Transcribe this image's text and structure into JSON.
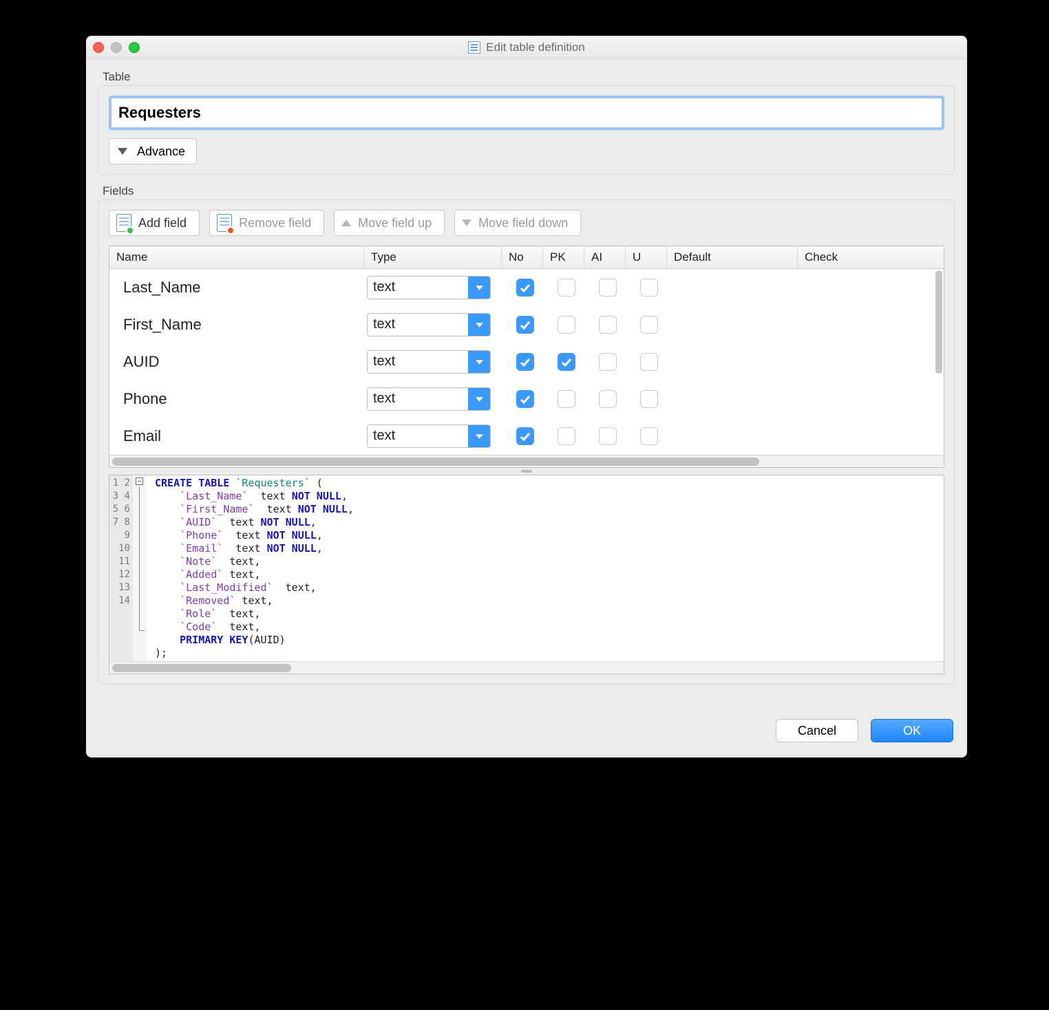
{
  "window": {
    "title": "Edit table definition"
  },
  "table_section": {
    "label": "Table",
    "name_value": "Requesters",
    "advance_label": "Advance"
  },
  "fields_section": {
    "label": "Fields",
    "toolbar": {
      "add": "Add field",
      "remove": "Remove field",
      "move_up": "Move field up",
      "move_down": "Move field down"
    },
    "columns": {
      "name": "Name",
      "type": "Type",
      "no": "No",
      "pk": "PK",
      "ai": "AI",
      "u": "U",
      "default": "Default",
      "check": "Check"
    },
    "rows": [
      {
        "name": "Last_Name",
        "type": "text",
        "no": true,
        "pk": false,
        "ai": false,
        "u": false,
        "default": "",
        "check": ""
      },
      {
        "name": "First_Name",
        "type": "text",
        "no": true,
        "pk": false,
        "ai": false,
        "u": false,
        "default": "",
        "check": ""
      },
      {
        "name": "AUID",
        "type": "text",
        "no": true,
        "pk": true,
        "ai": false,
        "u": false,
        "default": "",
        "check": ""
      },
      {
        "name": "Phone",
        "type": "text",
        "no": true,
        "pk": false,
        "ai": false,
        "u": false,
        "default": "",
        "check": ""
      },
      {
        "name": "Email",
        "type": "text",
        "no": true,
        "pk": false,
        "ai": false,
        "u": false,
        "default": "",
        "check": ""
      }
    ]
  },
  "sql": {
    "line_count": 14,
    "lines": [
      {
        "t": "kw",
        "text": "CREATE TABLE",
        "tail_tbl": "`Requesters`",
        "tail_plain": " ("
      },
      {
        "fld": "`Last_Name`",
        "plain": "  text ",
        "kw": "NOT NULL",
        "end": ","
      },
      {
        "fld": "`First_Name`",
        "plain": "  text ",
        "kw": "NOT NULL",
        "end": ","
      },
      {
        "fld": "`AUID`",
        "plain": "  text ",
        "kw": "NOT NULL",
        "end": ","
      },
      {
        "fld": "`Phone`",
        "plain": "  text ",
        "kw": "NOT NULL",
        "end": ","
      },
      {
        "fld": "`Email`",
        "plain": "  text ",
        "kw": "NOT NULL",
        "end": ","
      },
      {
        "fld": "`Note`",
        "plain": "  text,",
        "kw": "",
        "end": ""
      },
      {
        "fld": "`Added`",
        "plain": " text,",
        "kw": "",
        "end": ""
      },
      {
        "fld": "`Last_Modified`",
        "plain": "  text,",
        "kw": "",
        "end": ""
      },
      {
        "fld": "`Removed`",
        "plain": " text,",
        "kw": "",
        "end": ""
      },
      {
        "fld": "`Role`",
        "plain": "  text,",
        "kw": "",
        "end": ""
      },
      {
        "fld": "`Code`",
        "plain": "  text,",
        "kw": "",
        "end": ""
      },
      {
        "t": "kw",
        "text": "PRIMARY KEY",
        "tail_plain": "(AUID)"
      },
      {
        "plain_only": ");"
      }
    ]
  },
  "footer": {
    "cancel": "Cancel",
    "ok": "OK"
  }
}
